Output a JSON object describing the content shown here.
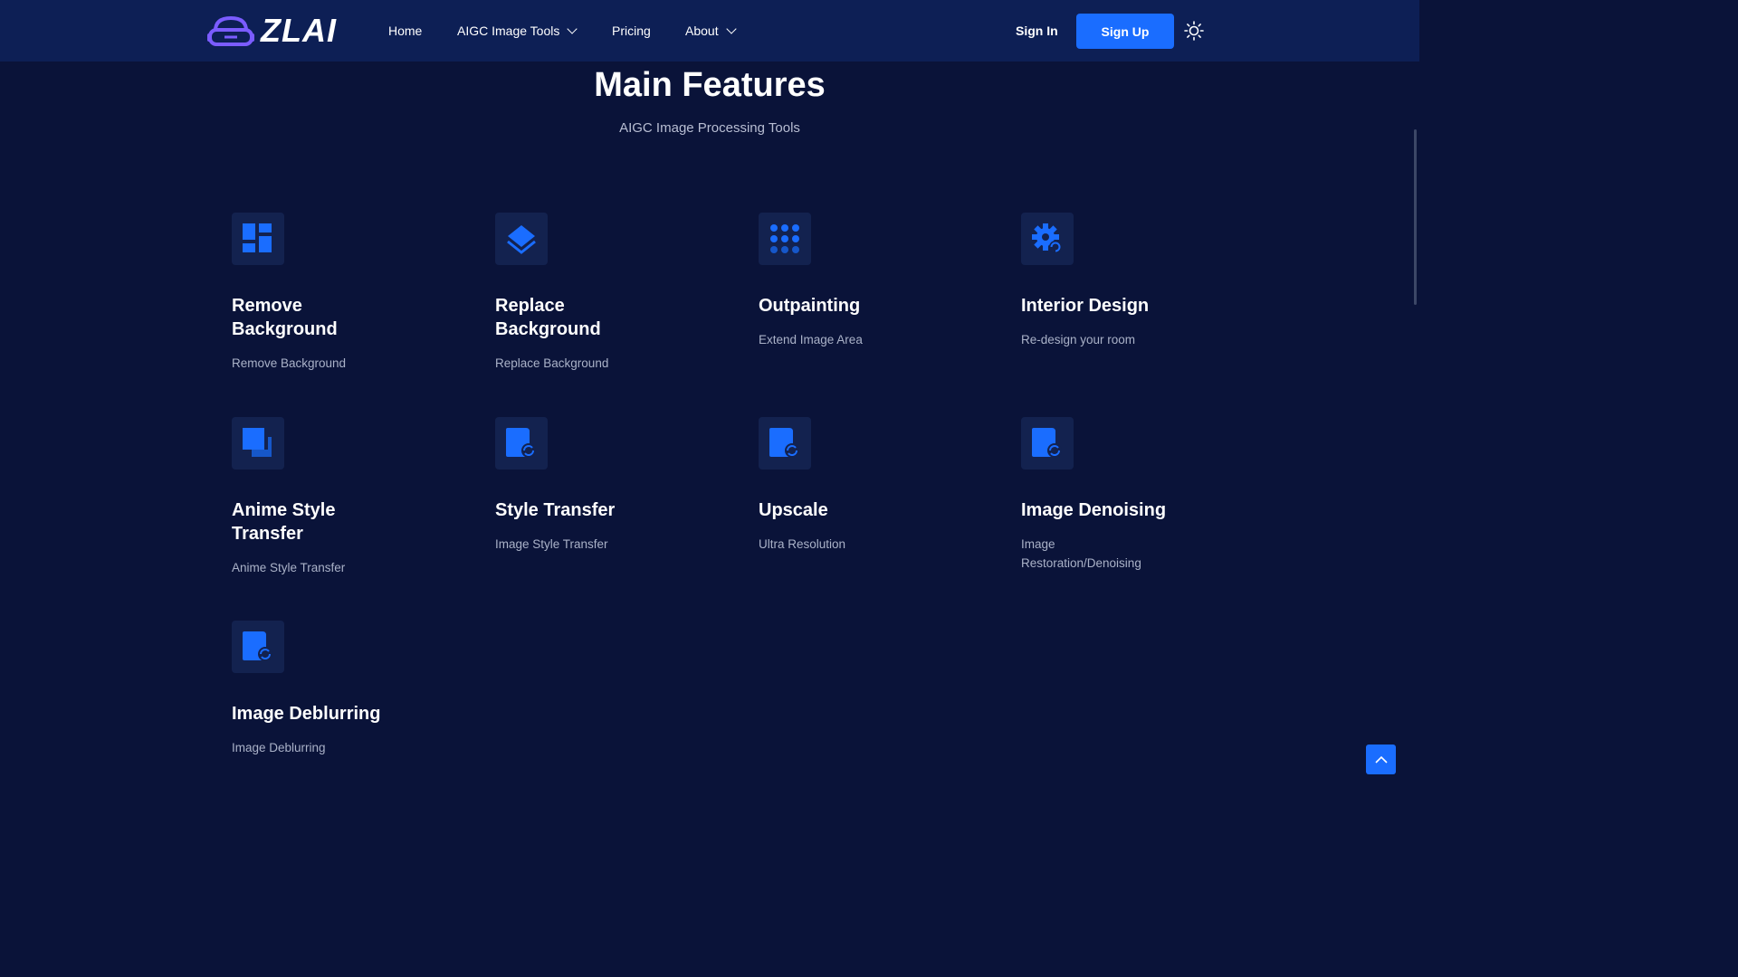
{
  "header": {
    "logo_text": "ZLAI",
    "nav": [
      {
        "label": "Home"
      },
      {
        "label": "AIGC Image Tools"
      },
      {
        "label": "Pricing"
      },
      {
        "label": "About"
      }
    ],
    "sign_in": "Sign In",
    "sign_up": "Sign Up",
    "theme_icon": "sun-icon"
  },
  "section": {
    "title": "Main Features",
    "subtitle": "AIGC Image Processing Tools"
  },
  "features": [
    {
      "title": "Remove Background",
      "desc": "Remove Background",
      "icon": "layout-grid-icon"
    },
    {
      "title": "Replace Background",
      "desc": "Replace Background",
      "icon": "layers-icon"
    },
    {
      "title": "Outpainting",
      "desc": "Extend Image Area",
      "icon": "dots-grid-icon"
    },
    {
      "title": "Interior Design",
      "desc": "Re-design your room",
      "icon": "gear-refresh-icon"
    },
    {
      "title": "Anime Style Transfer",
      "desc": "Anime Style Transfer",
      "icon": "copy-squares-icon"
    },
    {
      "title": "Style Transfer",
      "desc": "Image Style Transfer",
      "icon": "file-refresh-icon"
    },
    {
      "title": "Upscale",
      "desc": "Ultra Resolution",
      "icon": "file-refresh-icon"
    },
    {
      "title": "Image Denoising",
      "desc": "Image Restoration/Denoising",
      "icon": "file-refresh-icon"
    },
    {
      "title": "Image Deblurring",
      "desc": "Image Deblurring",
      "icon": "file-refresh-icon"
    }
  ],
  "colors": {
    "accent": "#1a6dff",
    "background": "#0a1339",
    "header_bg": "#0d1f55"
  }
}
